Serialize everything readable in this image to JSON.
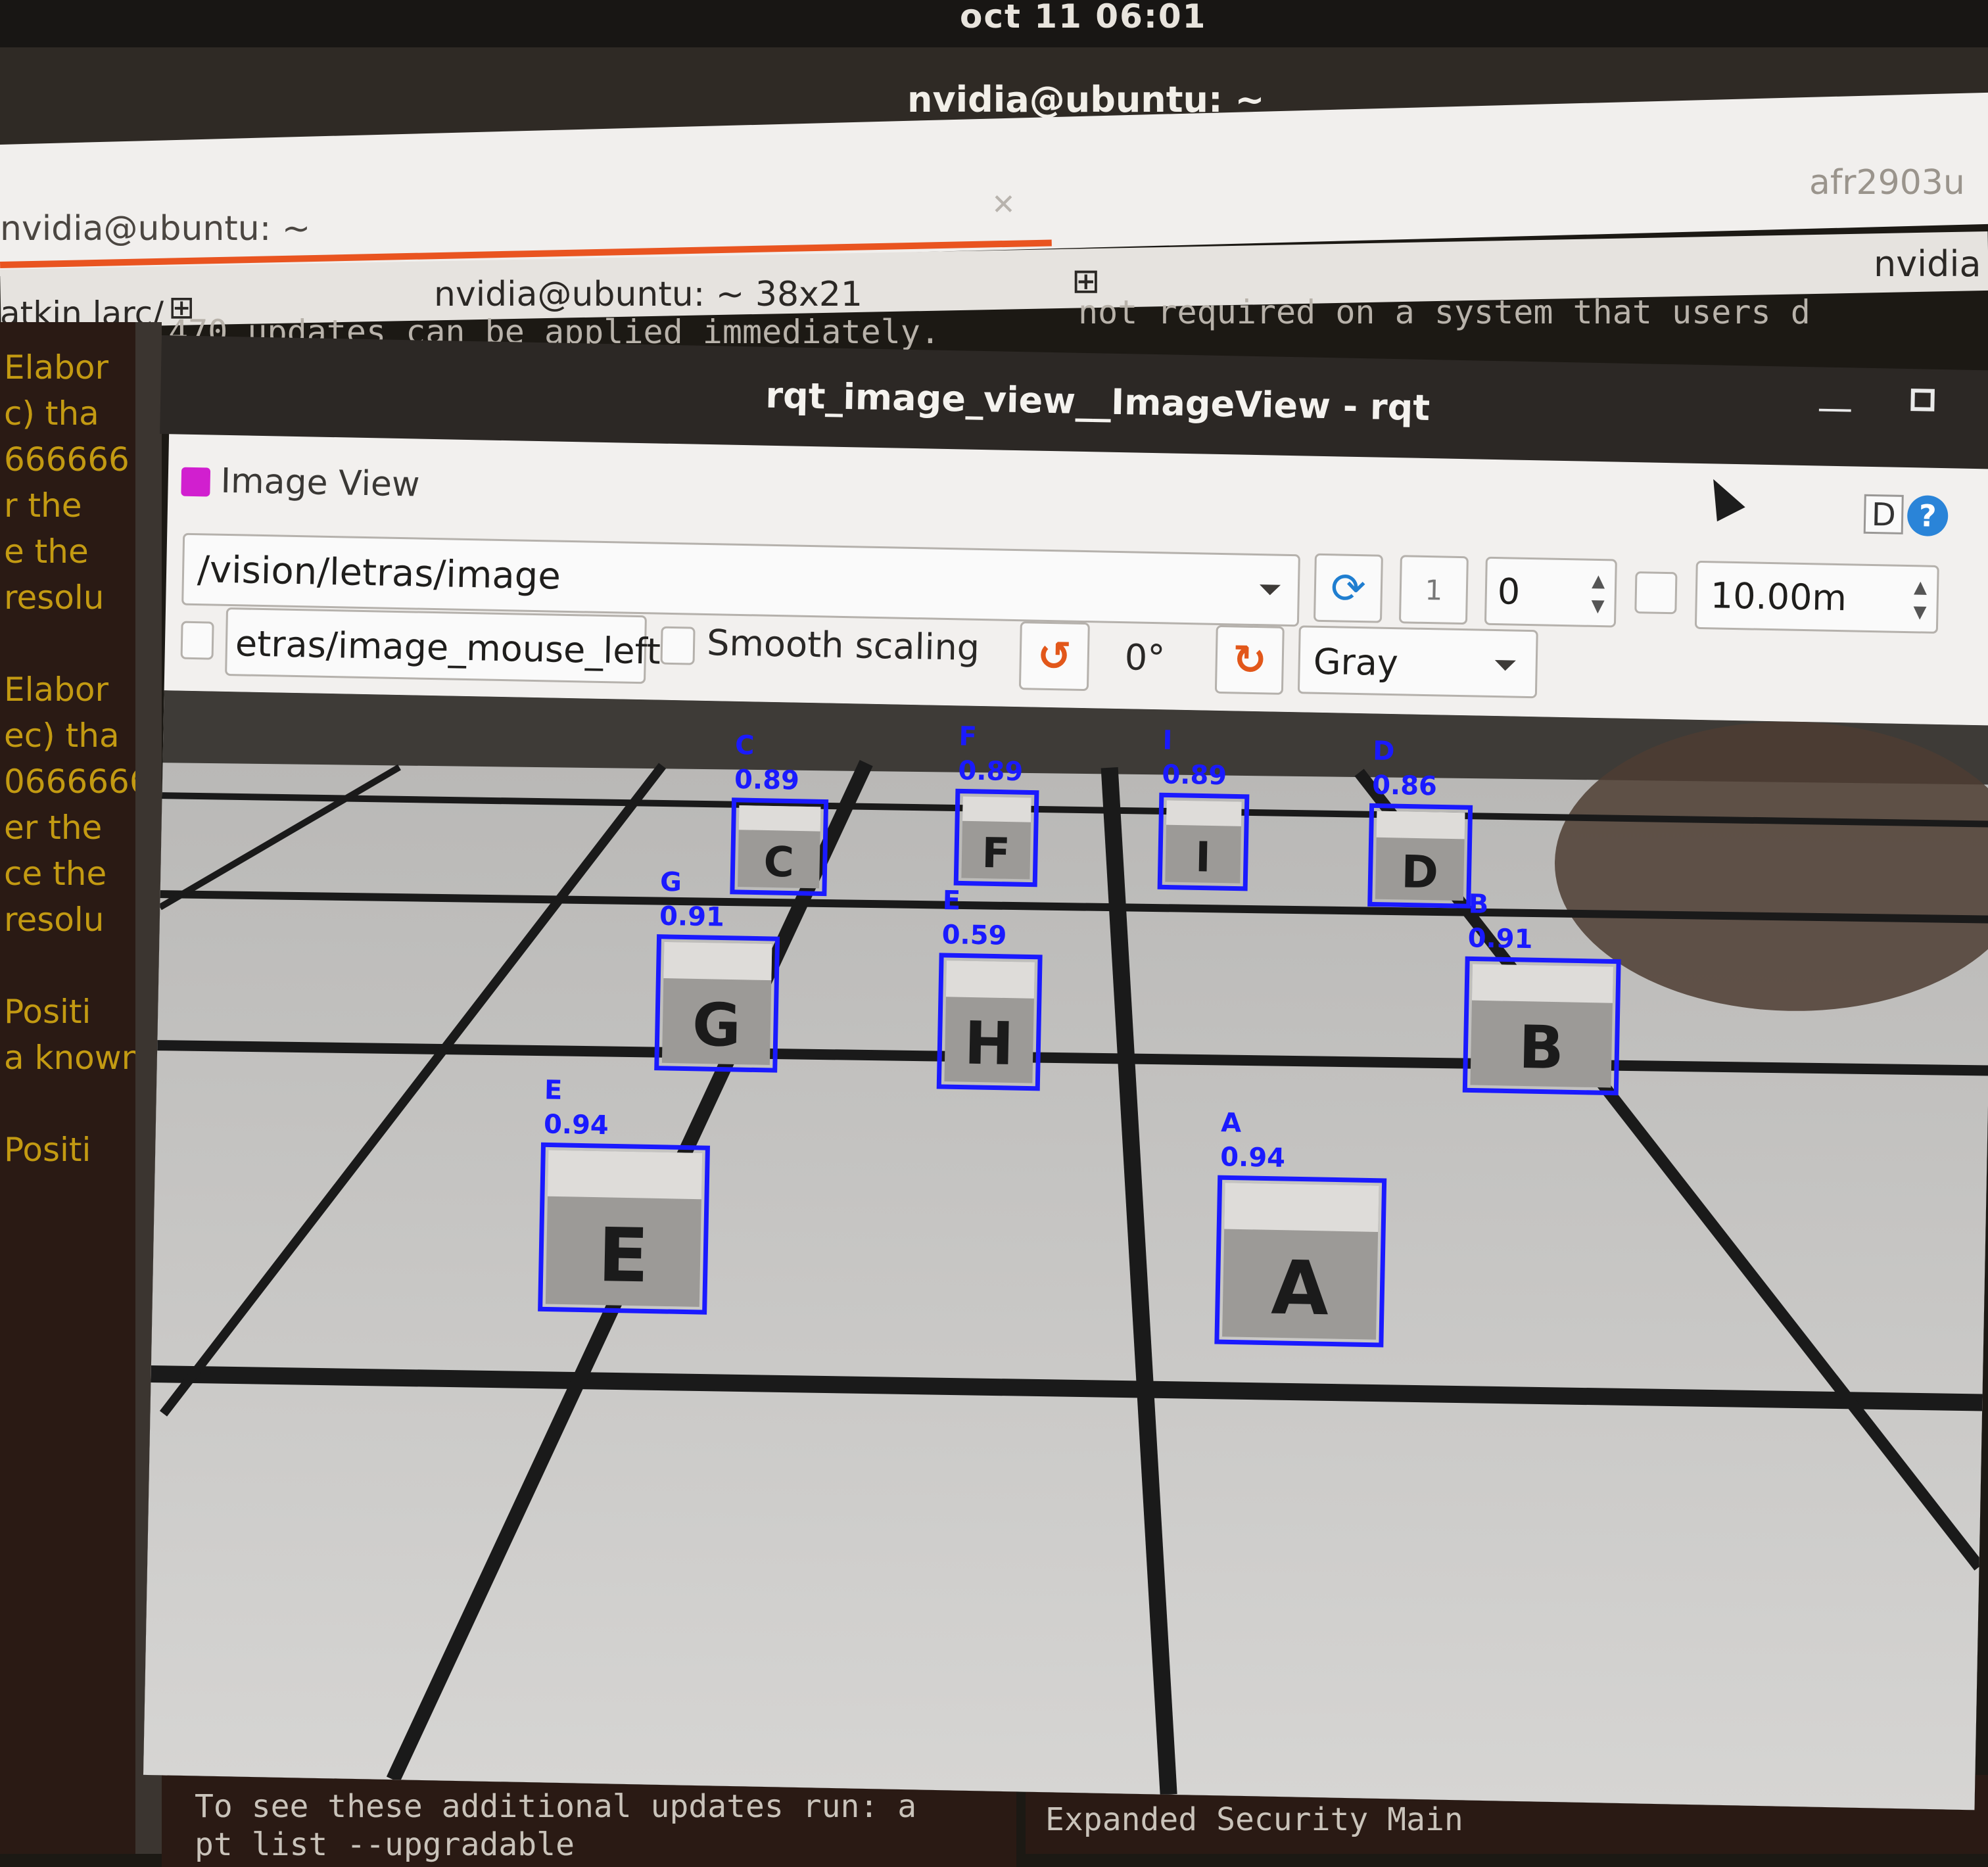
{
  "system": {
    "clock": "oct 11  06:01"
  },
  "terminal": {
    "window_title": "nvidia@ubuntu: ~",
    "tabs": [
      {
        "label": "nvidia@ubuntu: ~"
      },
      {
        "label": "afr2903u"
      }
    ],
    "panes": {
      "left_label": "atkin larc/",
      "middle_label": "nvidia@ubuntu: ~ 38x21",
      "right_label": "nvidia"
    },
    "left_lines": [
      "Elabor",
      "c) tha",
      "666666",
      "r the",
      "e the",
      "resolu",
      "",
      "Elabor",
      "ec) tha",
      "0666666",
      "er the",
      "ce the",
      "resolu",
      "",
      "Positi",
      "a known",
      "",
      "Positi"
    ],
    "middle_top_line": "470 updates can be applied immediately.",
    "right_top_line": "not required on a system that users d",
    "bottom_left_lines": [
      "To see these additional updates run: a",
      "pt list --upgradable"
    ],
    "bottom_right_line": "Expanded Security Main"
  },
  "rqt": {
    "window_title": "rqt_image_view__ImageView - rqt",
    "plugin_title": "Image View",
    "help_d_label": "D",
    "help_label": "?",
    "topic": "/vision/letras/image",
    "freeze_label": "1",
    "number_value": "0",
    "duration_value": "10.00m",
    "mouse_topic": "etras/image_mouse_left",
    "smooth_scaling_label": "Smooth scaling",
    "rotation_value": "0°",
    "color_scheme": "Gray",
    "detections": [
      {
        "letter": "C",
        "label": "C",
        "score": "0.89"
      },
      {
        "letter": "F",
        "label": "F",
        "score": "0.89"
      },
      {
        "letter": "I",
        "label": "I",
        "score": "0.89"
      },
      {
        "letter": "D",
        "label": "D",
        "score": "0.86"
      },
      {
        "letter": "G",
        "label": "G",
        "score": "0.91"
      },
      {
        "letter": "H",
        "label": "E",
        "score": "0.59"
      },
      {
        "letter": "B",
        "label": "B",
        "score": "0.91"
      },
      {
        "letter": "E",
        "label": "E",
        "score": "0.94"
      },
      {
        "letter": "A",
        "label": "A",
        "score": "0.94"
      }
    ]
  },
  "colors": {
    "ubuntu_orange": "#e95420",
    "detection_box": "#1a1aff",
    "terminal_text": "#c39a12",
    "refresh_blue": "#1f7ed0",
    "rotate_orange": "#e2571a"
  }
}
